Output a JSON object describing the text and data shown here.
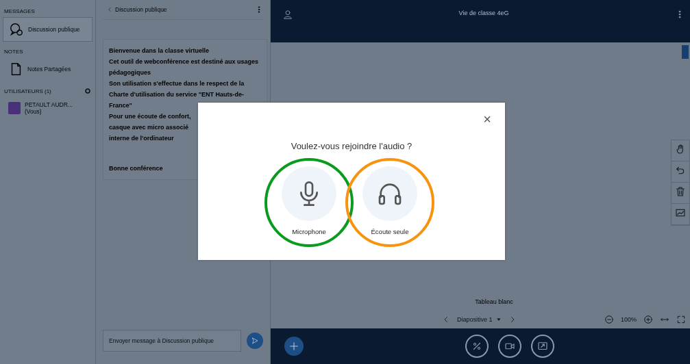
{
  "sidebar": {
    "sections": [
      {
        "heading": "MESSAGES",
        "items": [
          {
            "label": "Discussion publique",
            "kind": "chat",
            "selected": true
          }
        ]
      },
      {
        "heading": "NOTES",
        "items": [
          {
            "label": "Notes Partagées",
            "kind": "notes",
            "selected": false
          }
        ]
      },
      {
        "heading": "UTILISATEURS (1)",
        "items": [
          {
            "label": "PETAULT AUDR... (Vous)",
            "kind": "user",
            "selected": false
          }
        ]
      }
    ]
  },
  "chat": {
    "title": "Discussion publique",
    "messages": [
      {
        "lines": [
          "Bienvenue dans la classe virtuelle",
          "Cet outil de webconférence est destiné aux usages pédagogiques",
          "Son utilisation s'effectue dans le respect de la Charte d'utilisation du service \"ENT Hauts-de-France\"",
          "Pour une écoute de confort,",
          "casque avec micro associé",
          "interne de l'ordinateur"
        ]
      },
      {
        "lines": [
          "Bonne conférence"
        ]
      }
    ],
    "input": {
      "placeholder": "Envoyer message à Discussion publique"
    }
  },
  "topbar": {
    "title": "Vie de classe 4eG"
  },
  "whiteboard": {
    "label": "Tableau blanc",
    "slide": "Diapositive 1",
    "zoom": "100%"
  },
  "dialog": {
    "title": "Voulez-vous rejoindre l'audio ?",
    "close": "×",
    "options": [
      {
        "label": "Microphone",
        "kind": "microphone",
        "color": "#0a9a1e"
      },
      {
        "label": "Écoute seule",
        "kind": "listen",
        "color": "#f7930f"
      }
    ]
  }
}
